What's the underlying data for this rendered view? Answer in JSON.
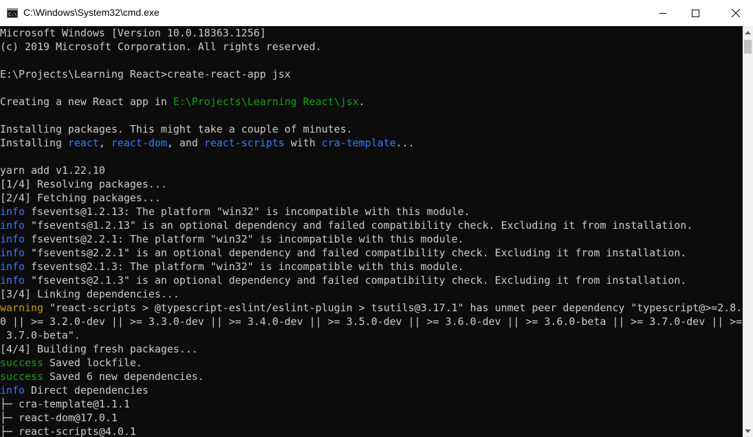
{
  "window": {
    "title": "C:\\Windows\\System32\\cmd.exe",
    "icon": "cmd-icon",
    "controls": [
      "minimize-icon",
      "maximize-icon",
      "close-icon"
    ]
  },
  "colors": {
    "background": "#0c0c0c",
    "text": "#cccccc",
    "green": "#13a10e",
    "blue": "#3b78ff",
    "yellow": "#c19c00"
  },
  "lines": [
    {
      "segments": [
        {
          "text": "Microsoft Windows [Version 10.0.18363.1256]",
          "c": ""
        }
      ]
    },
    {
      "segments": [
        {
          "text": "(c) 2019 Microsoft Corporation. All rights reserved.",
          "c": ""
        }
      ]
    },
    {
      "segments": []
    },
    {
      "segments": [
        {
          "text": "E:\\Projects\\Learning React>create-react-app jsx",
          "c": ""
        }
      ]
    },
    {
      "segments": []
    },
    {
      "segments": [
        {
          "text": "Creating a new React app in ",
          "c": ""
        },
        {
          "text": "E:\\Projects\\Learning React\\jsx",
          "c": "green"
        },
        {
          "text": ".",
          "c": ""
        }
      ]
    },
    {
      "segments": []
    },
    {
      "segments": [
        {
          "text": "Installing packages. This might take a couple of minutes.",
          "c": ""
        }
      ]
    },
    {
      "segments": [
        {
          "text": "Installing ",
          "c": ""
        },
        {
          "text": "react",
          "c": "blue"
        },
        {
          "text": ", ",
          "c": ""
        },
        {
          "text": "react-dom",
          "c": "blue"
        },
        {
          "text": ", and ",
          "c": ""
        },
        {
          "text": "react-scripts",
          "c": "blue"
        },
        {
          "text": " with ",
          "c": ""
        },
        {
          "text": "cra-template",
          "c": "blue"
        },
        {
          "text": "...",
          "c": ""
        }
      ]
    },
    {
      "segments": []
    },
    {
      "segments": [
        {
          "text": "yarn add v1.22.10",
          "c": ""
        }
      ]
    },
    {
      "segments": [
        {
          "text": "[1/4] Resolving packages...",
          "c": ""
        }
      ]
    },
    {
      "segments": [
        {
          "text": "[2/4] Fetching packages...",
          "c": ""
        }
      ]
    },
    {
      "segments": [
        {
          "text": "info",
          "c": "blue"
        },
        {
          "text": " fsevents@1.2.13: The platform \"win32\" is incompatible with this module.",
          "c": ""
        }
      ]
    },
    {
      "segments": [
        {
          "text": "info",
          "c": "blue"
        },
        {
          "text": " \"fsevents@1.2.13\" is an optional dependency and failed compatibility check. Excluding it from installation.",
          "c": ""
        }
      ]
    },
    {
      "segments": [
        {
          "text": "info",
          "c": "blue"
        },
        {
          "text": " fsevents@2.2.1: The platform \"win32\" is incompatible with this module.",
          "c": ""
        }
      ]
    },
    {
      "segments": [
        {
          "text": "info",
          "c": "blue"
        },
        {
          "text": " \"fsevents@2.2.1\" is an optional dependency and failed compatibility check. Excluding it from installation.",
          "c": ""
        }
      ]
    },
    {
      "segments": [
        {
          "text": "info",
          "c": "blue"
        },
        {
          "text": " fsevents@2.1.3: The platform \"win32\" is incompatible with this module.",
          "c": ""
        }
      ]
    },
    {
      "segments": [
        {
          "text": "info",
          "c": "blue"
        },
        {
          "text": " \"fsevents@2.1.3\" is an optional dependency and failed compatibility check. Excluding it from installation.",
          "c": ""
        }
      ]
    },
    {
      "segments": [
        {
          "text": "[3/4] Linking dependencies...",
          "c": ""
        }
      ]
    },
    {
      "segments": [
        {
          "text": "warning",
          "c": "yellow"
        },
        {
          "text": " \"react-scripts > @typescript-eslint/eslint-plugin > tsutils@3.17.1\" has unmet peer dependency \"typescript@>=2.8.",
          "c": ""
        }
      ]
    },
    {
      "segments": [
        {
          "text": "0 || >= 3.2.0-dev || >= 3.3.0-dev || >= 3.4.0-dev || >= 3.5.0-dev || >= 3.6.0-dev || >= 3.6.0-beta || >= 3.7.0-dev || >=",
          "c": ""
        }
      ]
    },
    {
      "segments": [
        {
          "text": " 3.7.0-beta\".",
          "c": ""
        }
      ]
    },
    {
      "segments": [
        {
          "text": "[4/4] Building fresh packages...",
          "c": ""
        }
      ]
    },
    {
      "segments": [
        {
          "text": "success",
          "c": "green"
        },
        {
          "text": " Saved lockfile.",
          "c": ""
        }
      ]
    },
    {
      "segments": [
        {
          "text": "success",
          "c": "green"
        },
        {
          "text": " Saved 6 new dependencies.",
          "c": ""
        }
      ]
    },
    {
      "segments": [
        {
          "text": "info",
          "c": "blue"
        },
        {
          "text": " Direct dependencies",
          "c": ""
        }
      ]
    },
    {
      "segments": [
        {
          "text": "├─ cra-template@1.1.1",
          "c": ""
        }
      ]
    },
    {
      "segments": [
        {
          "text": "├─ react-dom@17.0.1",
          "c": ""
        }
      ]
    },
    {
      "segments": [
        {
          "text": "├─ react-scripts@4.0.1",
          "c": ""
        }
      ]
    }
  ]
}
